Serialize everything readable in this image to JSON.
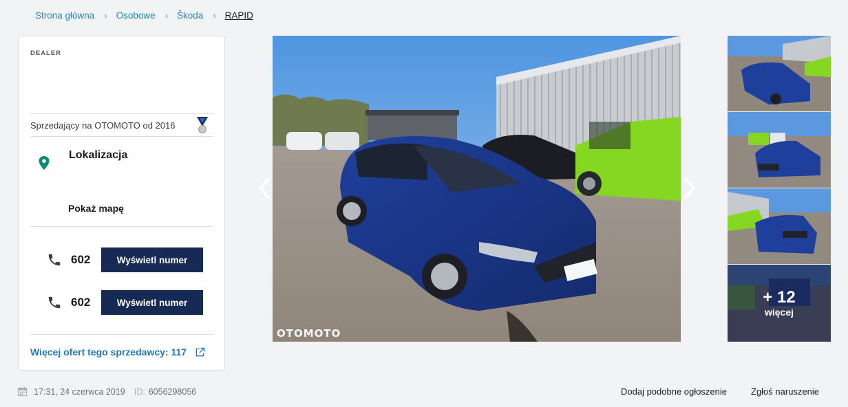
{
  "breadcrumb": {
    "items": [
      "Strona główna",
      "Osobowe",
      "Škoda"
    ],
    "current": "RAPID"
  },
  "dealer": {
    "label": "DEALER",
    "since_text": "Sprzedający na OTOMOTO od 2016",
    "location_title": "Lokalizacja",
    "map_link": "Pokaż mapę",
    "phones": [
      {
        "number": "602",
        "button": "Wyświetl numer"
      },
      {
        "number": "602",
        "button": "Wyświetl numer"
      }
    ],
    "more_offers": "Więcej ofert tego sprzedawcy: 117"
  },
  "gallery": {
    "watermark": "OTOMOTO",
    "more_count": "+ 12",
    "more_label": "więcej"
  },
  "meta": {
    "date": "17:31, 24 czerwca 2019",
    "id_label": "ID:",
    "id_value": "6056298056"
  },
  "footer": {
    "add_similar": "Dodaj podobne ogłoszenie",
    "report": "Zgłoś naruszenie"
  },
  "colors": {
    "link": "#2489b4",
    "button_bg": "#172a55",
    "pin": "#0e8a7a"
  },
  "icons": [
    "chevron-right-icon",
    "medal-icon",
    "location-pin-icon",
    "phone-icon",
    "external-link-icon",
    "calendar-icon",
    "arrow-left-icon",
    "arrow-right-icon"
  ]
}
